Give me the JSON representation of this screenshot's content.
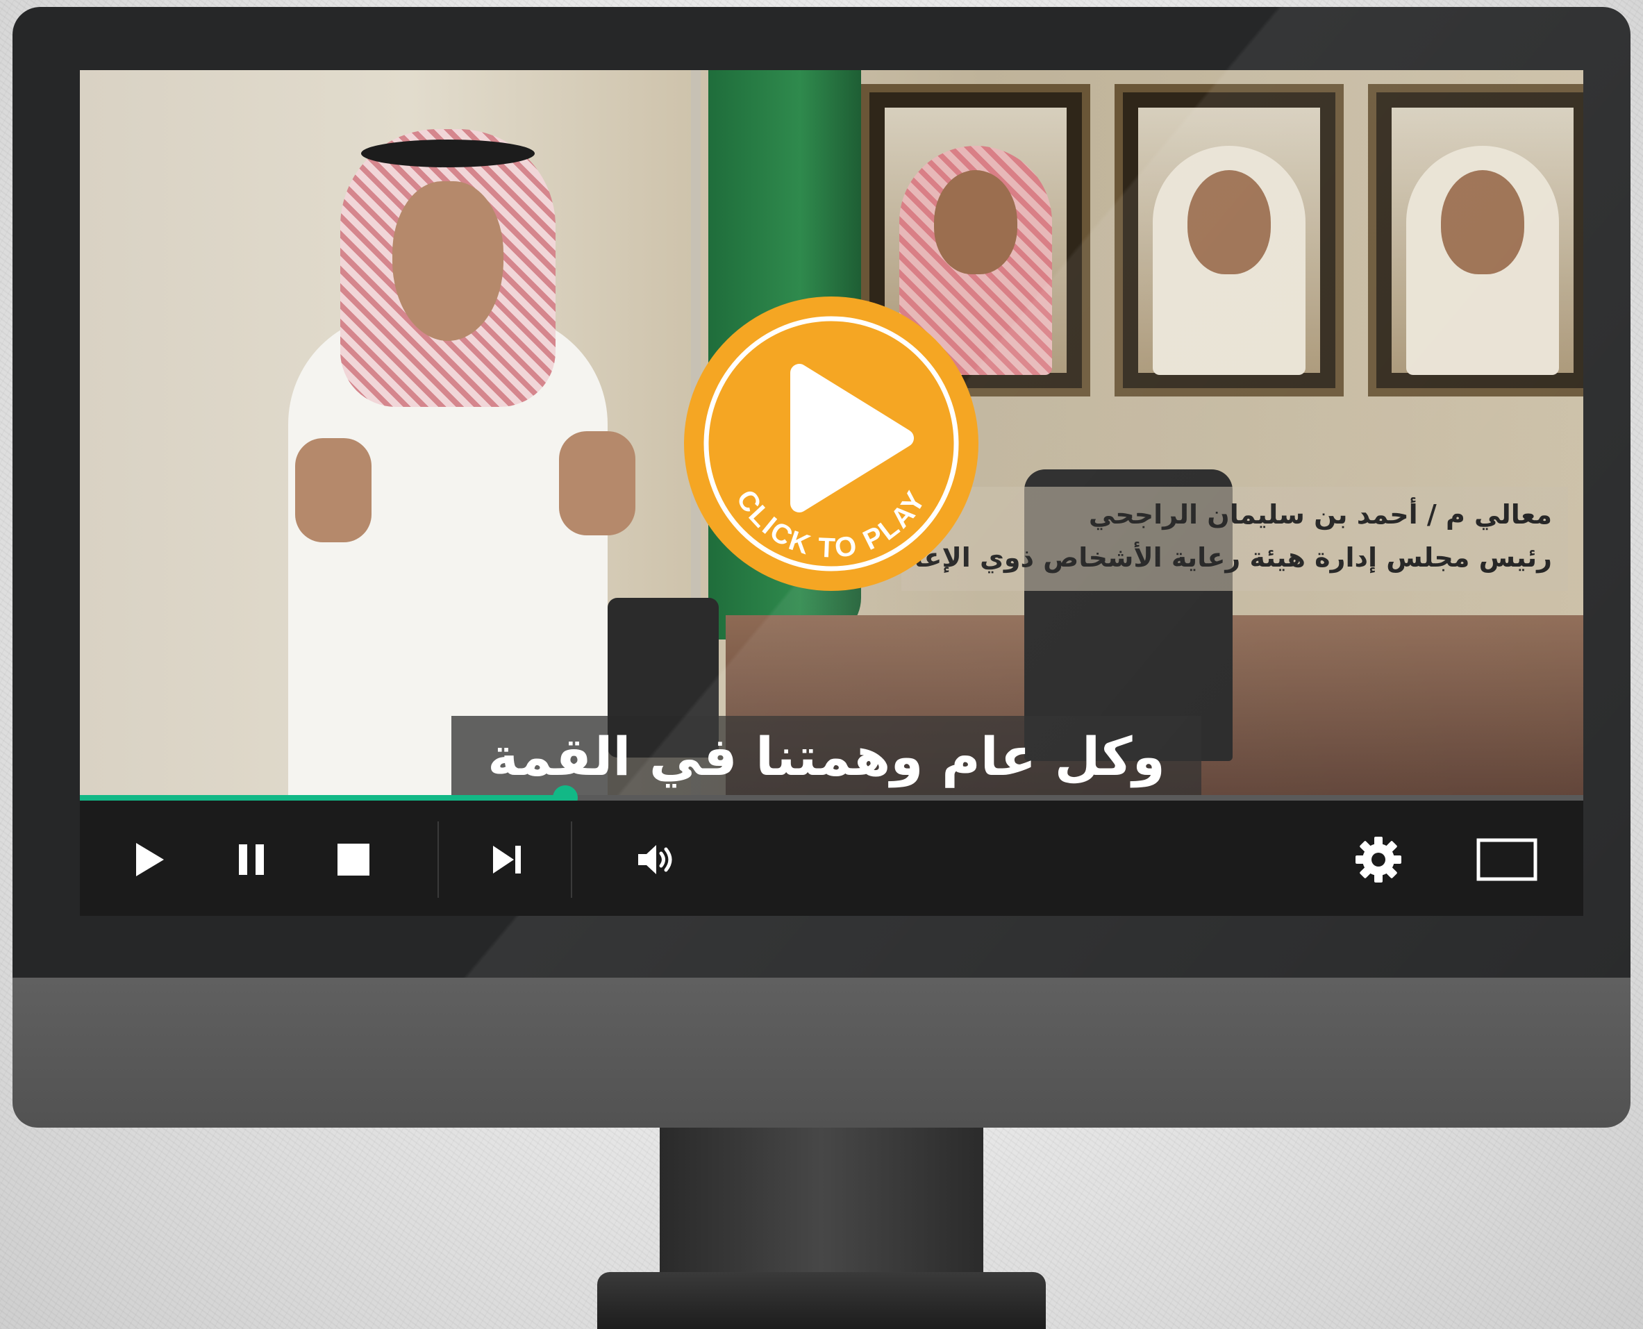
{
  "video": {
    "presenter_title": "معالي م / أحمد بن سليمان الراجحي",
    "presenter_role": "رئيس مجلس إدارة هيئة رعاية الأشخاص ذوي الإعاقة",
    "subtitle": "وكل عام وهمتنا في القمة"
  },
  "overlay": {
    "cta": "CLICK TO PLAY",
    "accent_color": "#f5a623"
  },
  "player": {
    "progress": 0.323,
    "accent_color": "#12b886",
    "controls": [
      "play-icon",
      "pause-icon",
      "stop-icon",
      "skip-next-icon",
      "volume-icon",
      "settings-gear-icon",
      "fullscreen-icon"
    ]
  }
}
